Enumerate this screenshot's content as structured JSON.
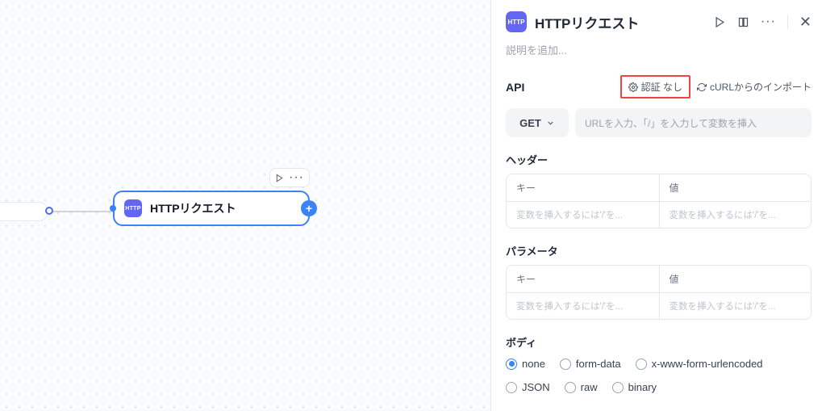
{
  "node": {
    "badge": "HTTP",
    "label": "HTTPリクエスト"
  },
  "panel": {
    "badge": "HTTP",
    "title": "HTTPリクエスト",
    "description_placeholder": "説明を追加...",
    "api_label": "API",
    "auth_label": "認証 なし",
    "curl_import_label": "cURLからのインポート",
    "method": "GET",
    "url_placeholder": "URLを入力、「/」を入力して変数を挿入",
    "headers_label": "ヘッダー",
    "kv_key_label": "キー",
    "kv_value_label": "値",
    "kv_placeholder": "変数を挿入するには'/'を...",
    "params_label": "パラメータ",
    "body_label": "ボディ",
    "body_options": [
      "none",
      "form-data",
      "x-www-form-urlencoded",
      "JSON",
      "raw",
      "binary"
    ],
    "body_selected": "none"
  }
}
